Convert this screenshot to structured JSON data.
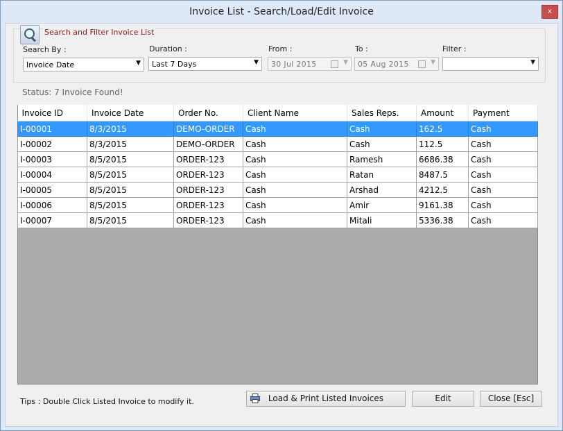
{
  "window": {
    "title": "Invoice List - Search/Load/Edit Invoice",
    "close_label": "x"
  },
  "filter": {
    "group_title": "Search and Filter Invoice List",
    "search_by_label": "Search By :",
    "search_by_value": "Invoice Date",
    "duration_label": "Duration :",
    "duration_value": "Last 7 Days",
    "from_label": "From :",
    "from_value": "30  Jul  2015",
    "to_label": "To :",
    "to_value": "05 Aug 2015",
    "filter_label": "Filter :",
    "filter_value": ""
  },
  "status": "Status: 7 Invoice Found!",
  "grid": {
    "columns": [
      "Invoice ID",
      "Invoice Date",
      "Order No.",
      "Client Name",
      "Sales Reps.",
      "Amount",
      "Payment"
    ],
    "rows": [
      [
        "I-00001",
        "8/3/2015",
        "DEMO-ORDER",
        "Cash",
        "Cash",
        "162.5",
        "Cash"
      ],
      [
        "I-00002",
        "8/3/2015",
        "DEMO-ORDER",
        "Cash",
        "Cash",
        "112.5",
        "Cash"
      ],
      [
        "I-00003",
        "8/5/2015",
        "ORDER-123",
        "Cash",
        "Ramesh",
        "6686.38",
        "Cash"
      ],
      [
        "I-00004",
        "8/5/2015",
        "ORDER-123",
        "Cash",
        "Ratan",
        "8487.5",
        "Cash"
      ],
      [
        "I-00005",
        "8/5/2015",
        "ORDER-123",
        "Cash",
        "Arshad",
        "4212.5",
        "Cash"
      ],
      [
        "I-00006",
        "8/5/2015",
        "ORDER-123",
        "Cash",
        "Amir",
        "9161.38",
        "Cash"
      ],
      [
        "I-00007",
        "8/5/2015",
        "ORDER-123",
        "Cash",
        "Mitali",
        "5336.38",
        "Cash"
      ]
    ],
    "selected_row": 0
  },
  "footer": {
    "tips": "Tips : Double Click Listed Invoice to modify it.",
    "load_print_label": "Load & Print Listed Invoices",
    "edit_label": "Edit",
    "close_label": "Close [Esc]"
  },
  "colors": {
    "selection": "#3399ff",
    "group_title": "#8b1a1a",
    "grid_background": "#ababab"
  }
}
